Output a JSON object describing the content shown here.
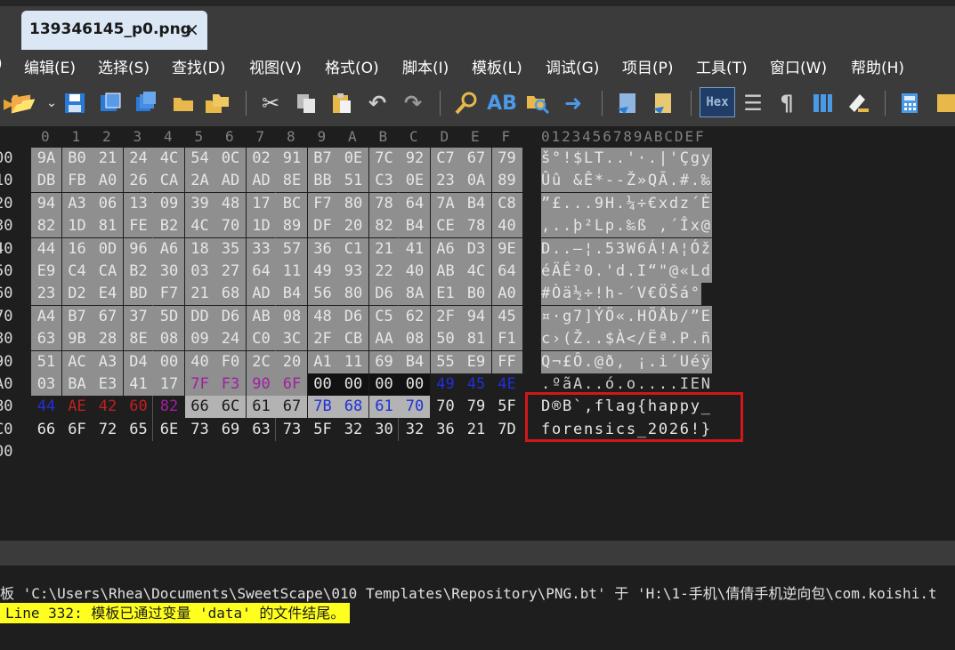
{
  "tab": {
    "title": "139346145_p0.png",
    "close": "×"
  },
  "menu": [
    ")",
    "编辑(E)",
    "选择(S)",
    "查找(D)",
    "视图(V)",
    "格式(O)",
    "脚本(I)",
    "模板(L)",
    "调试(G)",
    "项目(P)",
    "工具(T)",
    "窗口(W)",
    "帮助(H)"
  ],
  "toolbar": {
    "hex_label": "Hex"
  },
  "colors": {
    "selection_bg": "#8f8f8f",
    "selection_light_bg": "#b3b3b3",
    "default_text": "#e6e6e6",
    "purple": "#a020a0",
    "blue": "#2030d8",
    "red": "#c02020",
    "highlight_box": "#d0181b",
    "status_yellow": "#ffff1f"
  },
  "hex": {
    "column_headers": [
      "0",
      "1",
      "2",
      "3",
      "4",
      "5",
      "6",
      "7",
      "8",
      "9",
      "A",
      "B",
      "C",
      "D",
      "E",
      "F"
    ],
    "ascii_header": "0123456789ABCDEF",
    "rows": [
      {
        "addr": "00",
        "bytes": [
          "9A",
          "B0",
          "21",
          "24",
          "4C",
          "54",
          "0C",
          "02",
          "91",
          "B7",
          "0E",
          "7C",
          "92",
          "C7",
          "67",
          "79"
        ],
        "ascii": "š°!$LT..'·.|'Çgy"
      },
      {
        "addr": "10",
        "bytes": [
          "DB",
          "FB",
          "A0",
          "26",
          "CA",
          "2A",
          "AD",
          "AD",
          "8E",
          "BB",
          "51",
          "C3",
          "0E",
          "23",
          "0A",
          "89"
        ],
        "ascii": "Ûû &Ê*--Ž»QÃ.#.‰"
      },
      {
        "addr": "20",
        "bytes": [
          "94",
          "A3",
          "06",
          "13",
          "09",
          "39",
          "48",
          "17",
          "BC",
          "F7",
          "80",
          "78",
          "64",
          "7A",
          "B4",
          "C8"
        ],
        "ascii": "”£...9H.¼÷€xdz´È"
      },
      {
        "addr": "30",
        "bytes": [
          "82",
          "1D",
          "81",
          "FE",
          "B2",
          "4C",
          "70",
          "1D",
          "89",
          "DF",
          "20",
          "82",
          "B4",
          "CE",
          "78",
          "40"
        ],
        "ascii": ",..þ²Lp.‰ß ‚´Îx@"
      },
      {
        "addr": "40",
        "bytes": [
          "44",
          "16",
          "0D",
          "96",
          "A6",
          "18",
          "35",
          "33",
          "57",
          "36",
          "C1",
          "21",
          "41",
          "A6",
          "D3",
          "9E"
        ],
        "ascii": "D..–¦.53W6Á!A¦Óž"
      },
      {
        "addr": "50",
        "bytes": [
          "E9",
          "C4",
          "CA",
          "B2",
          "30",
          "03",
          "27",
          "64",
          "11",
          "49",
          "93",
          "22",
          "40",
          "AB",
          "4C",
          "64"
        ],
        "ascii": "éÄÊ²0.'d.I“\"@«Ld"
      },
      {
        "addr": "60",
        "bytes": [
          "23",
          "D2",
          "E4",
          "BD",
          "F7",
          "21",
          "68",
          "AD",
          "B4",
          "56",
          "80",
          "D6",
          "8A",
          "E1",
          "B0",
          "A0"
        ],
        "ascii": "#Òä½÷!h-´V€ÖŠá° "
      },
      {
        "addr": "70",
        "bytes": [
          "A4",
          "B7",
          "67",
          "37",
          "5D",
          "DD",
          "D6",
          "AB",
          "08",
          "48",
          "D6",
          "C5",
          "62",
          "2F",
          "94",
          "45"
        ],
        "ascii": "¤·g7]ÝÖ«.HÖÅb/”E"
      },
      {
        "addr": "80",
        "bytes": [
          "63",
          "9B",
          "28",
          "8E",
          "08",
          "09",
          "24",
          "C0",
          "3C",
          "2F",
          "CB",
          "AA",
          "08",
          "50",
          "81",
          "F1"
        ],
        "ascii": "c›(Ž..$À</Ëª.P.ñ"
      },
      {
        "addr": "90",
        "bytes": [
          "51",
          "AC",
          "A3",
          "D4",
          "00",
          "40",
          "F0",
          "2C",
          "20",
          "A1",
          "11",
          "69",
          "B4",
          "55",
          "E9",
          "FF"
        ],
        "ascii": "Q¬£Ô.@ð, ¡.i´Uéÿ"
      },
      {
        "addr": "A0",
        "bytes": [
          "03",
          "BA",
          "E3",
          "41",
          "17",
          "7F",
          "F3",
          "90",
          "6F",
          "00",
          "00",
          "00",
          "00",
          "49",
          "45",
          "4E"
        ],
        "ascii": ".ºãA..ó.o....IEN"
      },
      {
        "addr": "B0",
        "bytes": [
          "44",
          "AE",
          "42",
          "60",
          "82",
          "66",
          "6C",
          "61",
          "67",
          "7B",
          "68",
          "61",
          "70",
          "70",
          "79",
          "5F"
        ],
        "ascii": "D®B`‚flag{happy_"
      },
      {
        "addr": "C0",
        "bytes": [
          "66",
          "6F",
          "72",
          "65",
          "6E",
          "73",
          "69",
          "63",
          "73",
          "5F",
          "32",
          "30",
          "32",
          "36",
          "21",
          "7D"
        ],
        "ascii": "forensics_2026!}"
      },
      {
        "addr": "00",
        "bytes": [],
        "ascii": ""
      }
    ]
  },
  "output": {
    "line1": "板 'C:\\Users\\Rhea\\Documents\\SweetScape\\010 Templates\\Repository\\PNG.bt' 于 'H:\\1-手机\\倩倩手机逆向包\\com.koishi.t",
    "line2": "Line 332: 模板已通过变量 'data' 的文件结尾。"
  }
}
